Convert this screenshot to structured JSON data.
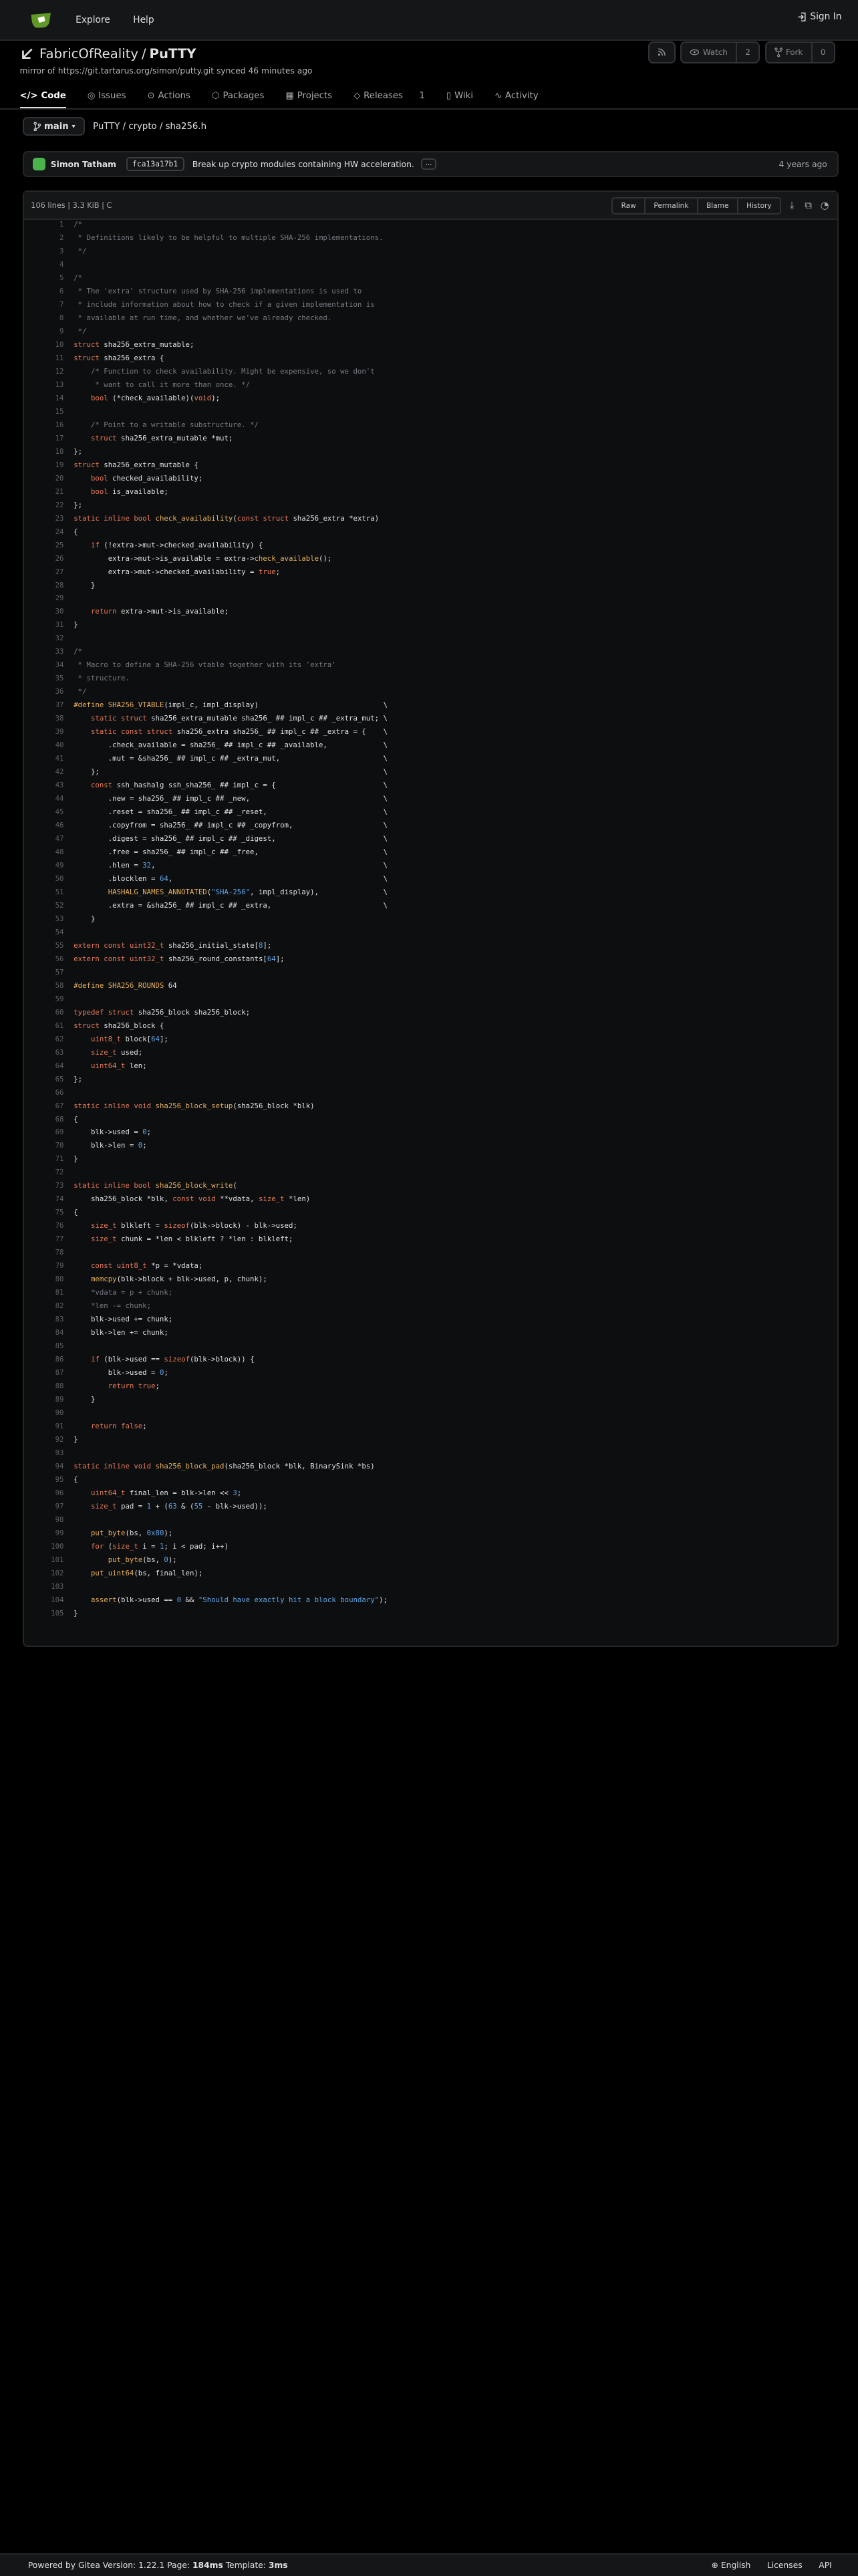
{
  "nav": {
    "explore": "Explore",
    "help": "Help",
    "signin": "Sign In"
  },
  "repo": {
    "owner": "FabricOfReality",
    "sep": "/",
    "name": "PuTTY",
    "mirror": "mirror of https://git.tartarus.org/simon/putty.git synced 46 minutes ago"
  },
  "header_buttons": {
    "watch": "Watch",
    "watch_count": "2",
    "fork": "Fork",
    "fork_count": "0"
  },
  "tabs": [
    {
      "label": "Code"
    },
    {
      "label": "Issues"
    },
    {
      "label": "Actions"
    },
    {
      "label": "Packages"
    },
    {
      "label": "Projects"
    },
    {
      "label": "Releases"
    },
    {
      "label": "1"
    },
    {
      "label": "Wiki"
    },
    {
      "label": "Activity"
    }
  ],
  "branch": {
    "name": "main",
    "path0": "PuTTY",
    "path1": "crypto",
    "path2": "sha256.h",
    "slash": "/"
  },
  "commit": {
    "author": "Simon Tatham",
    "sha": "fca13a17b1",
    "message": "Break up crypto modules containing HW acceleration.",
    "ellipsis": "…",
    "time": "4 years ago"
  },
  "file": {
    "info": "106 lines | 3.3 KiB | C",
    "raw": "Raw",
    "permalink": "Permalink",
    "blame": "Blame",
    "history": "History"
  },
  "code_lines": [
    "/*",
    " * Definitions likely to be helpful to multiple SHA-256 implementations.",
    " */",
    "",
    "/*",
    " * The 'extra' structure used by SHA-256 implementations is used to",
    " * include information about how to check if a given implementation is",
    " * available at run time, and whether we've already checked.",
    " */",
    "struct sha256_extra_mutable;",
    "struct sha256_extra {",
    "    /* Function to check availability. Might be expensive, so we don't",
    "     * want to call it more than once. */",
    "    bool (*check_available)(void);",
    "",
    "    /* Point to a writable substructure. */",
    "    struct sha256_extra_mutable *mut;",
    "};",
    "struct sha256_extra_mutable {",
    "    bool checked_availability;",
    "    bool is_available;",
    "};",
    "static inline bool check_availability(const struct sha256_extra *extra)",
    "{",
    "    if (!extra->mut->checked_availability) {",
    "        extra->mut->is_available = extra->check_available();",
    "        extra->mut->checked_availability = true;",
    "    }",
    "",
    "    return extra->mut->is_available;",
    "}",
    "",
    "/*",
    " * Macro to define a SHA-256 vtable together with its 'extra'",
    " * structure.",
    " */",
    "#define SHA256_VTABLE(impl_c, impl_display)                             \\",
    "    static struct sha256_extra_mutable sha256_ ## impl_c ## _extra_mut; \\",
    "    static const struct sha256_extra sha256_ ## impl_c ## _extra = {    \\",
    "        .check_available = sha256_ ## impl_c ## _available,             \\",
    "        .mut = &sha256_ ## impl_c ## _extra_mut,                        \\",
    "    };                                                                  \\",
    "    const ssh_hashalg ssh_sha256_ ## impl_c = {                         \\",
    "        .new = sha256_ ## impl_c ## _new,                               \\",
    "        .reset = sha256_ ## impl_c ## _reset,                           \\",
    "        .copyfrom = sha256_ ## impl_c ## _copyfrom,                     \\",
    "        .digest = sha256_ ## impl_c ## _digest,                         \\",
    "        .free = sha256_ ## impl_c ## _free,                             \\",
    "        .hlen = 32,                                                     \\",
    "        .blocklen = 64,                                                 \\",
    "        HASHALG_NAMES_ANNOTATED(\"SHA-256\", impl_display),               \\",
    "        .extra = &sha256_ ## impl_c ## _extra,                          \\",
    "    }",
    "",
    "extern const uint32_t sha256_initial_state[8];",
    "extern const uint32_t sha256_round_constants[64];",
    "",
    "#define SHA256_ROUNDS 64",
    "",
    "typedef struct sha256_block sha256_block;",
    "struct sha256_block {",
    "    uint8_t block[64];",
    "    size_t used;",
    "    uint64_t len;",
    "};",
    "",
    "static inline void sha256_block_setup(sha256_block *blk)",
    "{",
    "    blk->used = 0;",
    "    blk->len = 0;",
    "}",
    "",
    "static inline bool sha256_block_write(",
    "    sha256_block *blk, const void **vdata, size_t *len)",
    "{",
    "    size_t blkleft = sizeof(blk->block) - blk->used;",
    "    size_t chunk = *len < blkleft ? *len : blkleft;",
    "",
    "    const uint8_t *p = *vdata;",
    "    memcpy(blk->block + blk->used, p, chunk);",
    "    *vdata = p + chunk;",
    "    *len -= chunk;",
    "    blk->used += chunk;",
    "    blk->len += chunk;",
    "",
    "    if (blk->used == sizeof(blk->block)) {",
    "        blk->used = 0;",
    "        return true;",
    "    }",
    "",
    "    return false;",
    "}",
    "",
    "static inline void sha256_block_pad(sha256_block *blk, BinarySink *bs)",
    "{",
    "    uint64_t final_len = blk->len << 3;",
    "    size_t pad = 1 + (63 & (55 - blk->used));",
    "",
    "    put_byte(bs, 0x80);",
    "    for (size_t i = 1; i < pad; i++)",
    "        put_byte(bs, 0);",
    "    put_uint64(bs, final_len);",
    "",
    "    assert(blk->used == 0 && \"Should have exactly hit a block boundary\");",
    "}"
  ],
  "footer": {
    "powered": "Powered by Gitea",
    "version_label": "Version:",
    "version": "1.22.1",
    "page_label": "Page:",
    "page_time": "184ms",
    "template_label": "Template:",
    "template_time": "3ms",
    "lang": "English",
    "licenses": "Licenses",
    "api": "API"
  },
  "colors": {
    "bg": "#000000",
    "panel": "#151617",
    "keyword": "#e97a55",
    "comment": "#767b82",
    "string": "#5fa6e8",
    "macro": "#e8b15a",
    "gitea_green": "#609926"
  }
}
